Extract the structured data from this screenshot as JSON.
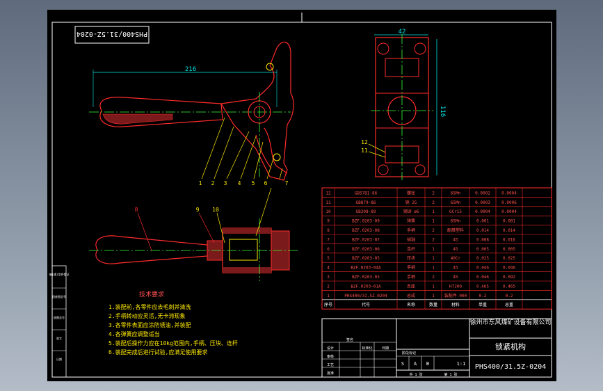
{
  "title_box": {
    "rotated_code": "PHS400/31.5Z-0204"
  },
  "dimensions": {
    "length": "216",
    "width": "42",
    "height": "116"
  },
  "leaders": [
    "1",
    "2",
    "3",
    "4",
    "5",
    "6",
    "7",
    "8",
    "9",
    "10",
    "11",
    "12"
  ],
  "tech_requirements": {
    "heading": "技术要求",
    "lines": [
      "1.装配前,各零件应去毛刺并清洗",
      "2.手柄转动应灵活,无卡滞现象",
      "3.各零件表面应涂防锈油,并装配",
      "4.各弹簧应调整适当",
      "5.装配后操作力应在10kg范围内,手柄、压块、连杆",
      "6.装配完成后进行试验,应满足使用要求"
    ]
  },
  "bom": {
    "rows": [
      {
        "no": "12",
        "code": "GB5781-86",
        "name": "螺栓",
        "qty": "2",
        "mat": "65Mn",
        "w1": "0.0002",
        "w2": "0.0004"
      },
      {
        "no": "11",
        "code": "GB879-86",
        "name": "销 25",
        "qty": "2",
        "mat": "65Mn",
        "w1": "0.0003",
        "w2": "0.0006"
      },
      {
        "no": "10",
        "code": "GB308-89",
        "name": "钢球 ø6",
        "qty": "1",
        "mat": "GCr15",
        "w1": "0.0004",
        "w2": "0.0004"
      },
      {
        "no": "9",
        "code": "BZF.0203-09",
        "name": "弹簧",
        "qty": "1",
        "mat": "65Mn",
        "w1": "0.001",
        "w2": "0.001"
      },
      {
        "no": "8",
        "code": "BZF.0203-08",
        "name": "手柄",
        "qty": "2",
        "mat": "酚醛塑料",
        "w1": "0.014",
        "w2": "0.014"
      },
      {
        "no": "7",
        "code": "BZF.0203-07",
        "name": "销轴",
        "qty": "2",
        "mat": "45",
        "w1": "0.008",
        "w2": "0.016"
      },
      {
        "no": "6",
        "code": "BZF.0203-06",
        "name": "连杆",
        "qty": "1",
        "mat": "45",
        "w1": "0.005",
        "w2": "0.005"
      },
      {
        "no": "5",
        "code": "BZF.0203-05",
        "name": "压块",
        "qty": "1",
        "mat": "40Cr",
        "w1": "0.025",
        "w2": "0.025"
      },
      {
        "no": "4",
        "code": "BZF.0203-04A",
        "name": "手柄",
        "qty": "1",
        "mat": "45",
        "w1": "0.046",
        "w2": "0.046"
      },
      {
        "no": "3",
        "code": "BZF.0203-03",
        "name": "手柄",
        "qty": "2",
        "mat": "45",
        "w1": "0.046",
        "w2": "0.092"
      },
      {
        "no": "2",
        "code": "BZF.0203-01A",
        "name": "支座",
        "qty": "1",
        "mat": "HT200",
        "w1": "0.465",
        "w2": "0.465"
      },
      {
        "no": "1",
        "code": "PHS400/31.5Z-0204",
        "name": "总成",
        "qty": "1",
        "mat": "装配件-000",
        "w1": "0.2",
        "w2": "0.2"
      }
    ],
    "header": {
      "no": "序号",
      "code": "代号",
      "name": "名称",
      "qty": "数量",
      "mat": "材料",
      "w1": "单重",
      "w2": "总重"
    }
  },
  "title_block": {
    "company": "徐州市东风煤矿设备有限公司",
    "drawing_name": "锁紧机构",
    "drawing_code": "PHS400/31.5Z-0204",
    "stage_label": "阶段标记",
    "stages": [
      "S",
      "A",
      "B"
    ],
    "scale": "1:1",
    "sheet_total": "共 1 张",
    "sheet_no": "第 1 张",
    "designer": "设计",
    "checker": "审核",
    "process": "工艺",
    "standard": "标准化",
    "approve": "批准",
    "date": "日期",
    "sign": "签名"
  },
  "side_block": {
    "labels": [
      "借(通)用件登记",
      "旧底图总号",
      "底图总号",
      "签字",
      "日期"
    ]
  }
}
